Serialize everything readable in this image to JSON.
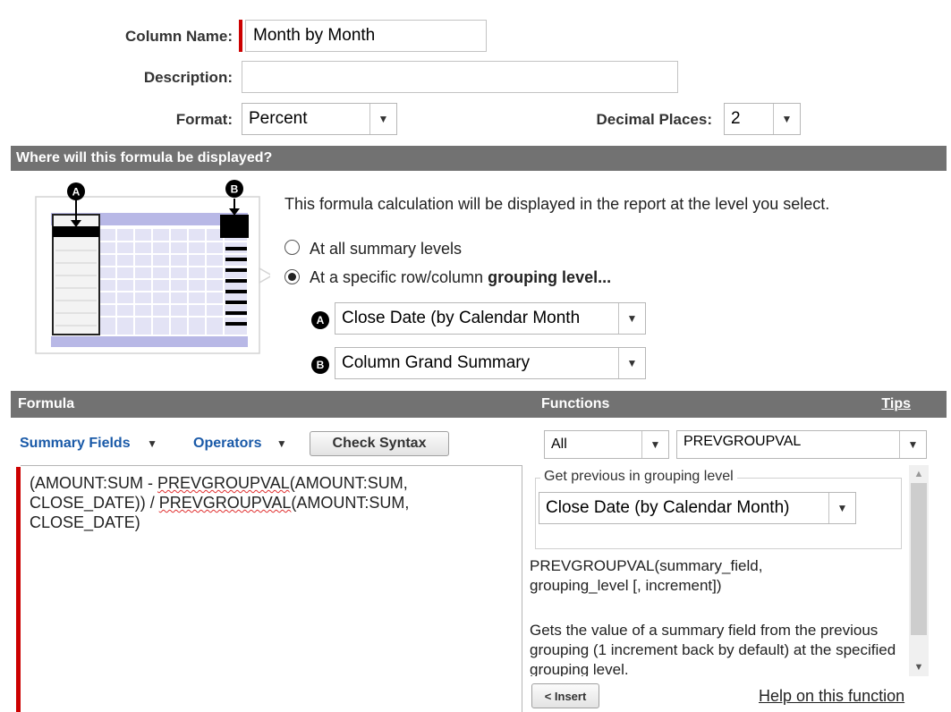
{
  "form": {
    "column_name_label": "Column Name:",
    "column_name_value": "Month by Month",
    "description_label": "Description:",
    "description_value": "",
    "format_label": "Format:",
    "format_value": "Percent",
    "decimal_label": "Decimal Places:",
    "decimal_value": "2"
  },
  "display": {
    "header": "Where will this formula be displayed?",
    "intro": "This formula calculation will be displayed in the report at the level you select.",
    "option_all": "At all summary levels",
    "option_specific_prefix": "At a specific row/column ",
    "option_specific_bold": "grouping level...",
    "selected_option": "specific",
    "badge_a": "A",
    "badge_b": "B",
    "row_grouping_value": "Close Date (by Calendar Month",
    "column_grouping_value": "Column Grand Summary"
  },
  "formula": {
    "header": "Formula",
    "summary_fields": "Summary Fields",
    "operators": "Operators",
    "check_syntax": "Check Syntax",
    "line1_pre": "(AMOUNT:SUM - ",
    "line1_fn": "PREVGROUPVAL",
    "line1_post": "(AMOUNT:SUM,",
    "line2_pre": "CLOSE_DATE)) / ",
    "line2_fn": "PREVGROUPVAL",
    "line2_post": "(AMOUNT:SUM,",
    "line3": "CLOSE_DATE)"
  },
  "functions": {
    "header": "Functions",
    "tips": "Tips",
    "category_value": "All",
    "function_value": "PREVGROUPVAL",
    "fieldset_legend": "Get previous in grouping level",
    "grouping_value": "Close Date (by Calendar Month)",
    "signature": "PREVGROUPVAL(summary_field, grouping_level [, increment])",
    "description": "Gets the value of a summary field from the previous grouping (1 increment back by default) at the specified grouping level.",
    "insert_button": "< Insert",
    "help_link": "Help on this function"
  },
  "colors": {
    "required": "#cc0000",
    "section_bar": "#727272",
    "link": "#1a5aa8",
    "diagram_header": "#b8b8e6"
  }
}
